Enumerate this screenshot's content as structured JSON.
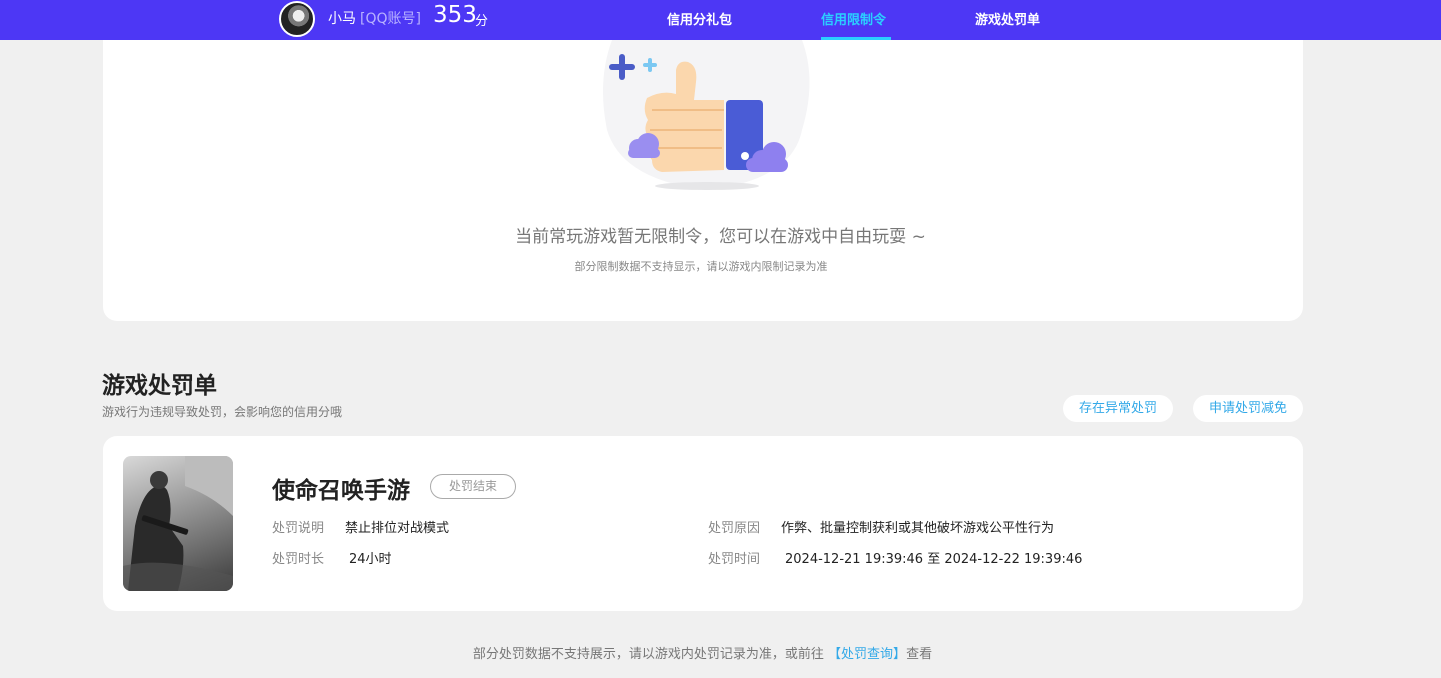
{
  "header": {
    "username": "小马",
    "account_type": "[QQ账号]",
    "score": "353",
    "score_unit": "分",
    "tabs": [
      "信用分礼包",
      "信用限制令",
      "游戏处罚单"
    ],
    "active_tab": "信用限制令"
  },
  "restriction": {
    "empty_title": "当前常玩游戏暂无限制令，您可以在游戏中自由玩耍 ~",
    "empty_subtitle": "部分限制数据不支持显示，请以游戏内限制记录为准"
  },
  "penalty_section": {
    "title": "游戏处罚单",
    "subtitle": "游戏行为违规导致处罚，会影响您的信用分哦",
    "actions": [
      "存在异常处罚",
      "申请处罚减免"
    ]
  },
  "penalty": {
    "game_name": "使命召唤手游",
    "status": "处罚结束",
    "desc_label": "处罚说明",
    "desc_value": "禁止排位对战模式",
    "duration_label": "处罚时长",
    "duration_value": "24小时",
    "reason_label": "处罚原因",
    "reason_value": "作弊、批量控制获利或其他破坏游戏公平性行为",
    "time_label": "处罚时间",
    "time_value": "2024-12-21 19:39:46 至 2024-12-22 19:39:46"
  },
  "footer": {
    "text_before": "部分处罚数据不支持展示，请以游戏内处罚记录为准，或前往 ",
    "link": "【处罚查询】",
    "text_after": "查看"
  },
  "colors": {
    "topbar": "#4d37f5",
    "active_tab": "#2ad0ff",
    "link": "#33a9e8"
  }
}
